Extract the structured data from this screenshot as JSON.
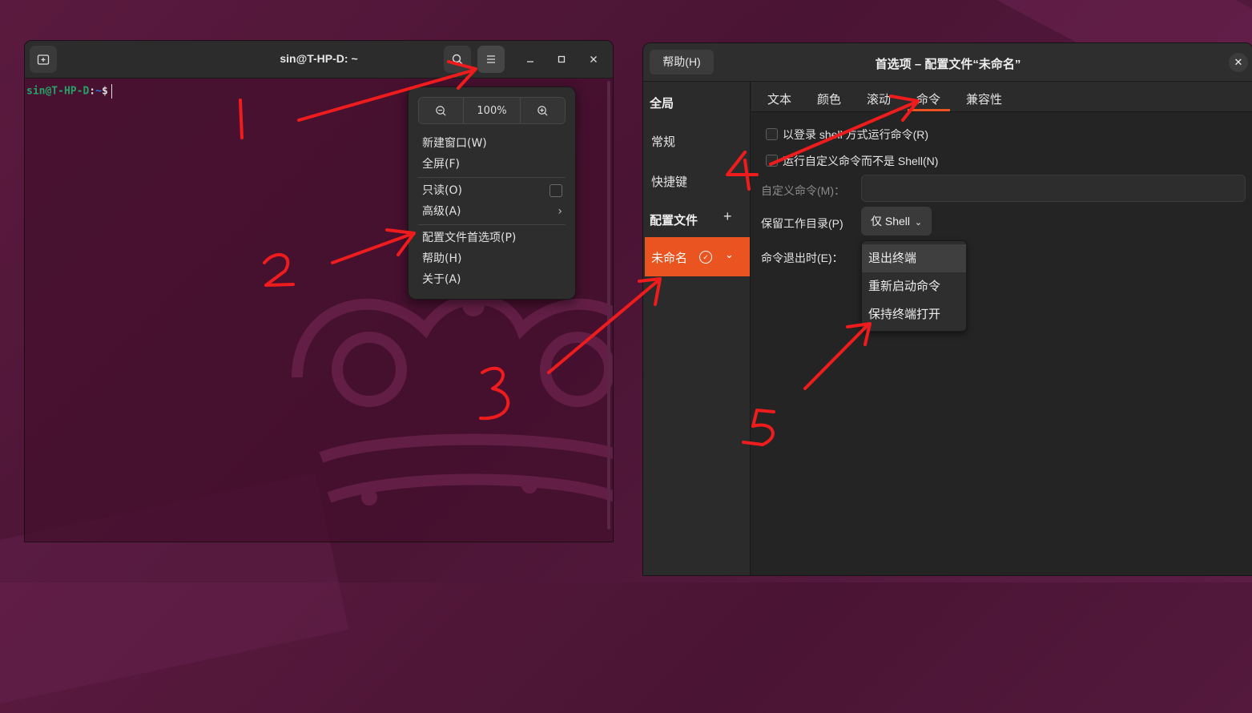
{
  "terminal": {
    "title": "sin@T-HP-D: ~",
    "prompt_user": "sin@T-HP-D",
    "prompt_sep": ":",
    "prompt_path": "~",
    "prompt_symbol": "$"
  },
  "menu": {
    "zoom_value": "100%",
    "items": {
      "new_window": "新建窗口(W)",
      "fullscreen": "全屏(F)",
      "readonly": "只读(O)",
      "advanced": "高级(A)",
      "profile_prefs": "配置文件首选项(P)",
      "help": "帮助(H)",
      "about": "关于(A)"
    }
  },
  "prefs": {
    "help_label": "帮助(H)",
    "title": "首选项 – 配置文件“未命名”",
    "sidebar": {
      "global_header": "全局",
      "general": "常规",
      "shortcuts": "快捷键",
      "profiles_header": "配置文件",
      "profile_name": "未命名"
    },
    "tabs": [
      "文本",
      "颜色",
      "滚动",
      "命令",
      "兼容性"
    ],
    "command": {
      "login_shell": "以登录 shell 方式运行命令(R)",
      "custom_cmd_check": "运行自定义命令而不是 Shell(N)",
      "custom_cmd_label": "自定义命令(M)：",
      "preserve_dir_label": "保留工作目录(P)",
      "preserve_dir_value": "仅 Shell",
      "on_exit_label": "命令退出时(E)：",
      "on_exit_options": [
        "退出终端",
        "重新启动命令",
        "保持终端打开"
      ]
    }
  },
  "annotations": [
    "1",
    "2",
    "3",
    "4",
    "5"
  ],
  "colors": {
    "accent": "#e95420",
    "prompt_user": "#26a269",
    "prompt_path": "#2a7bde",
    "annotation": "#ee1c1c"
  }
}
